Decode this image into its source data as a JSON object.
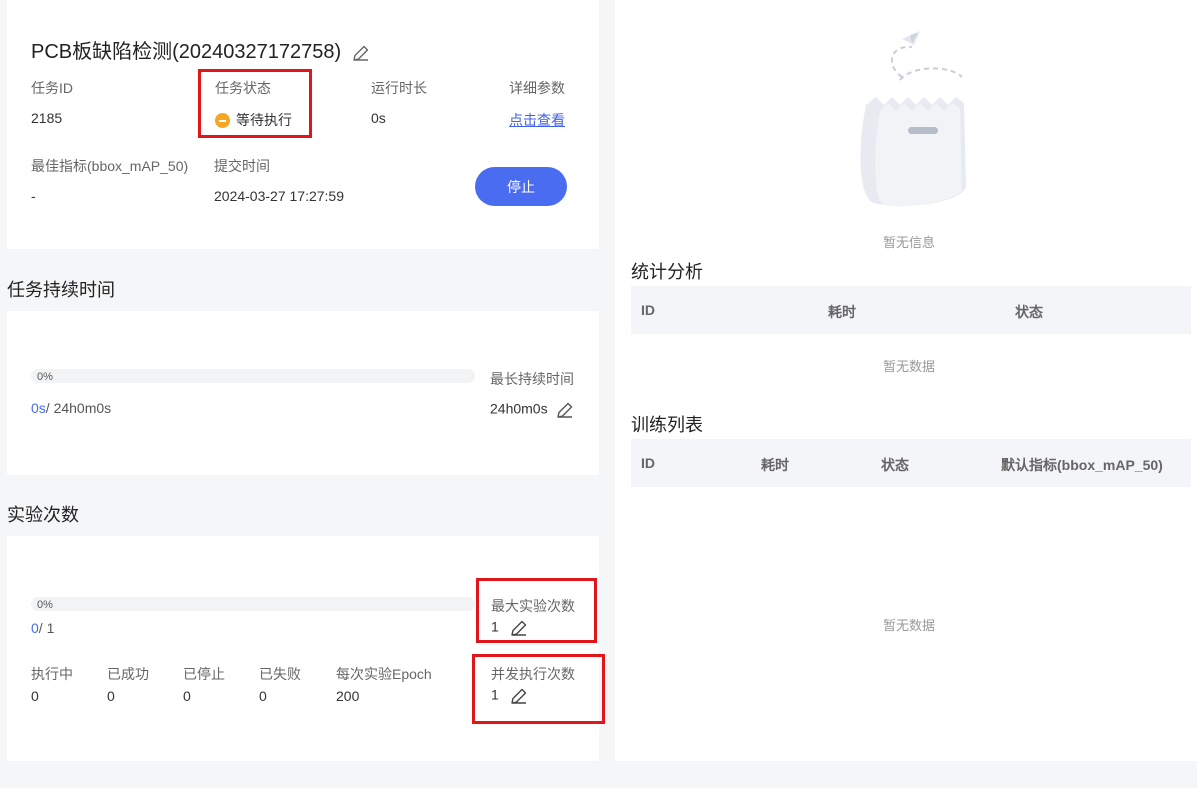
{
  "task": {
    "title": "PCB板缺陷检测(20240327172758)",
    "id_label": "任务ID",
    "id_value": "2185",
    "status_label": "任务状态",
    "status_value": "等待执行",
    "status_color": "#f5a623",
    "runtime_label": "运行时长",
    "runtime_value": "0s",
    "params_label": "详细参数",
    "params_link": "点击查看",
    "metric_label": "最佳指标(bbox_mAP_50)",
    "metric_value": "-",
    "submit_label": "提交时间",
    "submit_value": "2024-03-27 17:27:59",
    "stop_button": "停止"
  },
  "duration": {
    "section_title": "任务持续时间",
    "percent": "0%",
    "progress_fraction": 0,
    "elapsed": "0s",
    "total": "/ 24h0m0s",
    "max_label": "最长持续时间",
    "max_value": "24h0m0s"
  },
  "experiments": {
    "section_title": "实验次数",
    "percent": "0%",
    "progress_fraction": 0,
    "done": "0",
    "total": "/ 1",
    "max_label": "最大实验次数",
    "max_value": "1",
    "concurrent_label": "并发执行次数",
    "concurrent_value": "1",
    "stats": [
      {
        "label": "执行中",
        "value": "0"
      },
      {
        "label": "已成功",
        "value": "0"
      },
      {
        "label": "已停止",
        "value": "0"
      },
      {
        "label": "已失败",
        "value": "0"
      },
      {
        "label": "每次实验Epoch",
        "value": "200"
      }
    ]
  },
  "right": {
    "empty_info": "暂无信息",
    "stats_title": "统计分析",
    "stats_columns": [
      "ID",
      "耗时",
      "状态"
    ],
    "stats_empty": "暂无数据",
    "train_title": "训练列表",
    "train_columns": [
      "ID",
      "耗时",
      "状态",
      "默认指标(bbox_mAP_50)"
    ],
    "train_empty": "暂无数据"
  },
  "colors": {
    "accent": "#4a6cf0",
    "highlight_box": "#e0161b"
  },
  "icons": [
    "edit-icon",
    "status-pending-icon",
    "empty-bag-illustration"
  ]
}
